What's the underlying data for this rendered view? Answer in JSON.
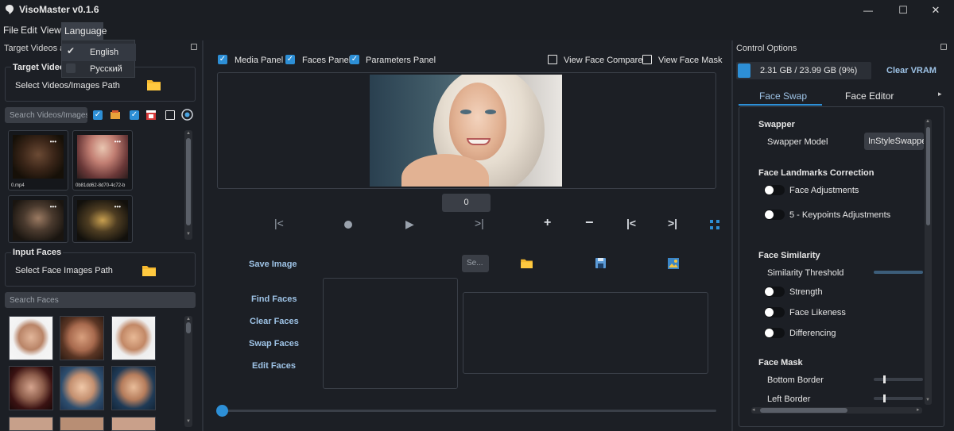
{
  "window": {
    "title": "VisoMaster v0.1.6",
    "minimize": "—",
    "maximize": "☐",
    "close": "✕"
  },
  "menu": {
    "file": "File",
    "edit": "Edit",
    "view": "View",
    "language": "Language",
    "language_options": [
      {
        "label": "English",
        "checked": true
      },
      {
        "label": "Русский",
        "checked": false
      }
    ]
  },
  "left": {
    "panel_title": "Target Videos and Inputs",
    "target_group_title": "Target Videos/Images",
    "select_target_path": "Select Videos/Images Path",
    "search_videos_placeholder": "Search Videos/Images",
    "target_thumbs": [
      "0.mp4",
      "0b81dd62-8d70-4c72-b",
      "",
      ""
    ],
    "input_group_title": "Input Faces",
    "select_face_path": "Select Face Images Path",
    "search_faces_placeholder": "Search Faces"
  },
  "center": {
    "media_panel": "Media Panel",
    "faces_panel": "Faces Panel",
    "parameters_panel": "Parameters Panel",
    "view_face_compare": "View Face Compare",
    "view_face_mask": "View Face Mask",
    "frame_number": "0",
    "save_image": "Save Image",
    "save_input": "Se...",
    "find_faces": "Find Faces",
    "clear_faces": "Clear Faces",
    "swap_faces": "Swap Faces",
    "edit_faces": "Edit Faces"
  },
  "right": {
    "panel_title": "Control Options",
    "vram_text": "2.31 GB / 23.99 GB (9%)",
    "vram_fraction": 0.09,
    "clear_vram": "Clear VRAM",
    "tab_face_swap": "Face Swap",
    "tab_face_editor": "Face Editor",
    "swapper_section": "Swapper",
    "swapper_model_label": "Swapper Model",
    "swapper_model_value": "InStyleSwapper",
    "landmarks_section": "Face Landmarks Correction",
    "face_adjustments": "Face Adjustments",
    "keypoints_adjustments": "5 - Keypoints Adjustments",
    "similarity_section": "Face Similarity",
    "similarity_threshold": "Similarity Threshold",
    "strength": "Strength",
    "face_likeness": "Face Likeness",
    "differencing": "Differencing",
    "mask_section": "Face Mask",
    "bottom_border": "Bottom Border",
    "left_border": "Left Border"
  },
  "colors": {
    "accent": "#2d8fd6",
    "label_blue": "#9ec3e6",
    "folder": "#f5b82e"
  }
}
